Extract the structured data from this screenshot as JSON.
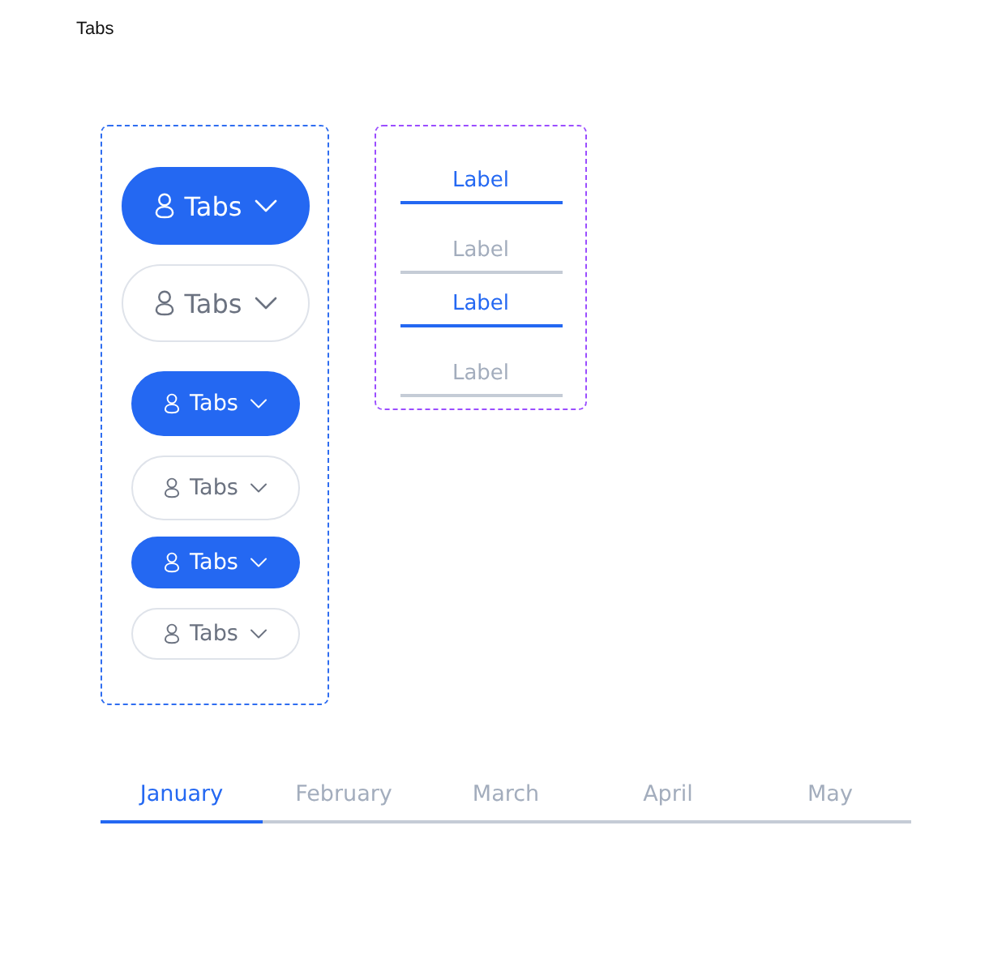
{
  "page_title": "Tabs",
  "pill_tabs": [
    {
      "label": "Tabs",
      "kind": "large",
      "selected": true
    },
    {
      "label": "Tabs",
      "kind": "large",
      "selected": false
    },
    {
      "label": "Tabs",
      "kind": "medium",
      "selected": true
    },
    {
      "label": "Tabs",
      "kind": "medium",
      "selected": false
    },
    {
      "label": "Tabs",
      "kind": "small",
      "selected": true
    },
    {
      "label": "Tabs",
      "kind": "small",
      "selected": false
    }
  ],
  "underline_tabs": [
    {
      "label": "Label",
      "selected": true
    },
    {
      "label": "Label",
      "selected": false
    },
    {
      "label": "Label",
      "selected": true
    },
    {
      "label": "Label",
      "selected": false
    }
  ],
  "month_tabs": [
    {
      "label": "January",
      "selected": true
    },
    {
      "label": "February",
      "selected": false
    },
    {
      "label": "March",
      "selected": false
    },
    {
      "label": "April",
      "selected": false
    },
    {
      "label": "May",
      "selected": false
    }
  ]
}
